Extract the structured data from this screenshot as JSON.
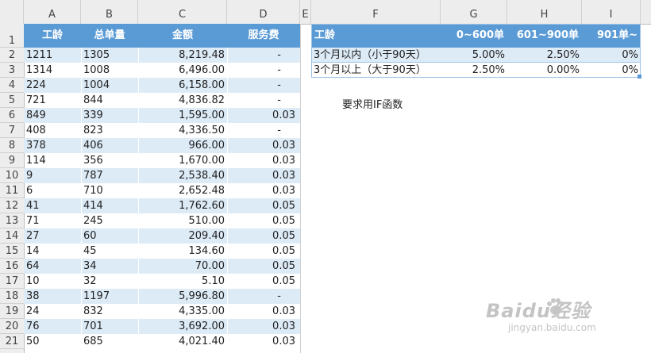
{
  "column_headers": [
    "A",
    "B",
    "C",
    "D",
    "E",
    "F",
    "G",
    "H",
    "I"
  ],
  "row_numbers": [
    "1",
    "2",
    "3",
    "4",
    "5",
    "6",
    "7",
    "8",
    "9",
    "10",
    "11",
    "12",
    "13",
    "14",
    "15",
    "16",
    "17",
    "18",
    "19",
    "20",
    "21"
  ],
  "left_table": {
    "headers": [
      "工龄",
      "总单量",
      "金额",
      "服务费"
    ],
    "rows": [
      [
        "1211",
        "1305",
        "8,219.48",
        "-"
      ],
      [
        "1314",
        "1008",
        "6,496.00",
        "-"
      ],
      [
        "224",
        "1004",
        "6,158.00",
        "-"
      ],
      [
        "721",
        "844",
        "4,836.82",
        "-"
      ],
      [
        "849",
        "339",
        "1,595.00",
        "0.03"
      ],
      [
        "408",
        "823",
        "4,336.50",
        "-"
      ],
      [
        "378",
        "406",
        "966.00",
        "0.03"
      ],
      [
        "114",
        "356",
        "1,670.00",
        "0.03"
      ],
      [
        "9",
        "787",
        "2,538.40",
        "0.03"
      ],
      [
        "6",
        "710",
        "2,652.48",
        "0.03"
      ],
      [
        "41",
        "414",
        "1,762.60",
        "0.05"
      ],
      [
        "71",
        "245",
        "510.00",
        "0.05"
      ],
      [
        "27",
        "60",
        "209.40",
        "0.05"
      ],
      [
        "14",
        "45",
        "134.60",
        "0.05"
      ],
      [
        "64",
        "34",
        "70.00",
        "0.05"
      ],
      [
        "10",
        "32",
        "5.10",
        "0.05"
      ],
      [
        "38",
        "1197",
        "5,996.80",
        "-"
      ],
      [
        "24",
        "832",
        "4,335.00",
        "0.03"
      ],
      [
        "76",
        "701",
        "3,692.00",
        "0.03"
      ],
      [
        "50",
        "685",
        "4,021.40",
        "0.03"
      ]
    ]
  },
  "right_table": {
    "headers": [
      "工龄",
      "0~600单",
      "601~900单",
      "901单~"
    ],
    "rows": [
      [
        "3个月以内（小于90天）",
        "5.00%",
        "2.50%",
        "0%"
      ],
      [
        "3个月以上（大于90天）",
        "2.50%",
        "0.00%",
        "0%"
      ]
    ]
  },
  "note": "要求用IF函数",
  "watermark": {
    "brand": "Baidu经验",
    "url": "jingyan.baidu.com"
  },
  "colors": {
    "header_blue": "#5b9bd5",
    "band_light": "#ddebf7",
    "grid_header": "#ededed"
  }
}
